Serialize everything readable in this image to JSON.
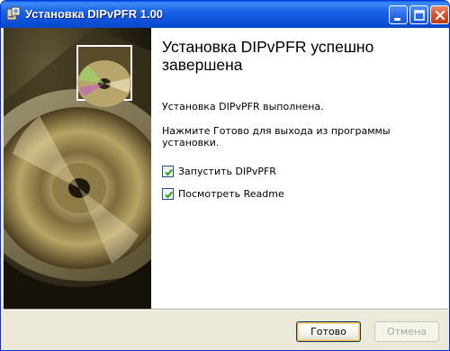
{
  "window": {
    "title": "Установка DIPvPFR 1.00"
  },
  "main": {
    "heading": "Установка DIPvPFR успешно завершена",
    "line1": "Установка DIPvPFR выполнена.",
    "line2": "Нажмите Готово для выхода из программы установки."
  },
  "options": [
    {
      "label": "Запустить DIPvPFR",
      "checked": true
    },
    {
      "label": "Посмотреть Readme",
      "checked": true
    }
  ],
  "buttons": {
    "finish": "Готово",
    "cancel": "Отмена"
  },
  "colors": {
    "titlebar": "#0a4fd6",
    "dialog_bg": "#ece9d8",
    "button_border": "#003c74"
  }
}
